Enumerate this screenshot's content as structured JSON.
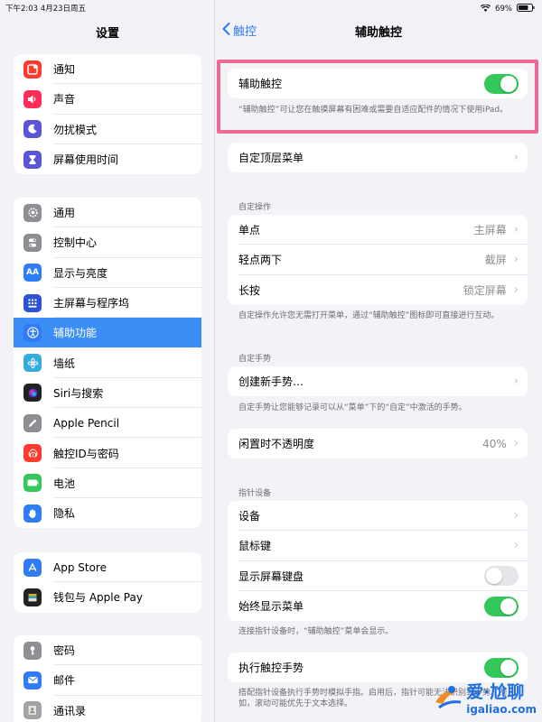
{
  "status": {
    "time_date": "下午2:03   4月23日周五",
    "battery": "69%"
  },
  "left_title": "设置",
  "groups": [
    [
      {
        "label": "通知",
        "icon": "notifications-icon",
        "color": "#ff3b30"
      },
      {
        "label": "声音",
        "icon": "sound-icon",
        "color": "#ff2d55"
      },
      {
        "label": "勿扰模式",
        "icon": "moon-icon",
        "color": "#5856d6"
      },
      {
        "label": "屏幕使用时间",
        "icon": "hourglass-icon",
        "color": "#5856d6"
      }
    ],
    [
      {
        "label": "通用",
        "icon": "gear-icon",
        "color": "#8e8e93"
      },
      {
        "label": "控制中心",
        "icon": "switches-icon",
        "color": "#8e8e93"
      },
      {
        "label": "显示与亮度",
        "icon": "display-icon",
        "color": "#2f7cf6"
      },
      {
        "label": "主屏幕与程序坞",
        "icon": "home-grid-icon",
        "color": "#2f52d0"
      },
      {
        "label": "辅助功能",
        "icon": "accessibility-icon",
        "color": "#2f7cf6",
        "selected": true
      },
      {
        "label": "墙纸",
        "icon": "wallpaper-icon",
        "color": "#35aadc"
      },
      {
        "label": "Siri与搜索",
        "icon": "siri-icon",
        "color": "#222222"
      },
      {
        "label": "Apple Pencil",
        "icon": "pencil-icon",
        "color": "#8e8e93"
      },
      {
        "label": "触控ID与密码",
        "icon": "fingerprint-icon",
        "color": "#ff3b30"
      },
      {
        "label": "电池",
        "icon": "battery-icon",
        "color": "#34c759"
      },
      {
        "label": "隐私",
        "icon": "hand-icon",
        "color": "#2f7cf6"
      }
    ],
    [
      {
        "label": "App Store",
        "icon": "app-store-icon",
        "color": "#2f7cf6"
      },
      {
        "label": "钱包与 Apple Pay",
        "icon": "wallet-icon",
        "color": "#222222"
      }
    ],
    [
      {
        "label": "密码",
        "icon": "key-icon",
        "color": "#8e8e93"
      },
      {
        "label": "邮件",
        "icon": "mail-icon",
        "color": "#2f7cf6"
      },
      {
        "label": "通讯录",
        "icon": "contacts-icon",
        "color": "#a2a2a7"
      }
    ]
  ],
  "nav": {
    "back": "触控",
    "title": "辅助触控"
  },
  "assistive": {
    "label": "辅助触控",
    "on": true,
    "desc": "“辅助触控”可让您在触摸屏幕有困难或需要自适应配件的情况下使用iPad。"
  },
  "top_menu": "自定顶层菜单",
  "custom_actions": {
    "header": "自定操作",
    "rows": [
      {
        "label": "单点",
        "value": "主屏幕"
      },
      {
        "label": "轻点两下",
        "value": "截屏"
      },
      {
        "label": "长按",
        "value": "锁定屏幕"
      }
    ],
    "footer": "自定操作允许您无需打开菜单，通过“辅助触控”图标即可直接进行互动。"
  },
  "custom_gestures": {
    "header": "自定手势",
    "row": "创建新手势…",
    "footer": "自定手势让您能够记录可以从“菜单”下的“自定”中激活的手势。"
  },
  "idle": {
    "label": "闲置时不透明度",
    "value": "40%"
  },
  "pointer": {
    "header": "指针设备",
    "rows": [
      {
        "label": "设备"
      },
      {
        "label": "鼠标键"
      }
    ],
    "toggles": [
      {
        "label": "显示屏幕键盘",
        "on": false
      },
      {
        "label": "始终显示菜单",
        "on": true
      }
    ],
    "footer": "连接指针设备时，“辅助触控”菜单会显示。"
  },
  "perform": {
    "label": "执行触控手势",
    "on": true,
    "footer": "搭配指针设备执行手势时模拟手指。启用后，指针可能无法识别到手势。例如，滚动可能优先于文本选择。"
  },
  "watermark": {
    "cn": "爱·尬聊",
    "url": "igaliao.com"
  }
}
